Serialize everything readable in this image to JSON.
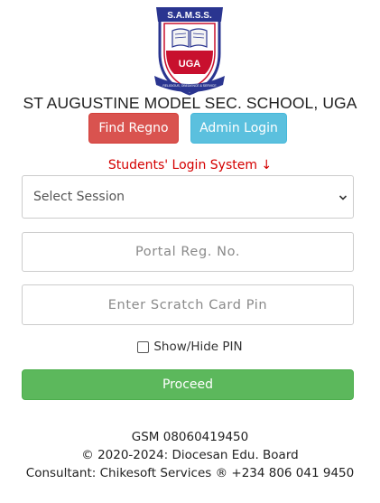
{
  "logo": {
    "banner_text": "S.A.M.S.S.",
    "shield_text": "UGA",
    "motto_text": "RELIGIOUS, OBEDIENCE & SERVICE"
  },
  "header": {
    "school_name": "ST AUGUSTINE MODEL SEC. SCHOOL, UGA"
  },
  "actions": {
    "find_regno": "Find Regno",
    "admin_login": "Admin Login"
  },
  "login": {
    "title": "Students' Login System ↓",
    "session_select_value": "Select Session",
    "reg_placeholder": "Portal Reg. No.",
    "pin_placeholder": "Enter Scratch Card Pin",
    "show_hide_label": "Show/Hide PIN",
    "proceed_label": "Proceed"
  },
  "footer": {
    "gsm": "GSM 08060419450",
    "copyright": "© 2020-2024: Diocesan Edu. Board",
    "consultant": "Consultant: Chikesoft Services ® +234 806 041 9450"
  },
  "colors": {
    "danger": "#d9534f",
    "info": "#5bc0de",
    "success": "#5cb85c",
    "title_red": "#d40000",
    "logo_navy": "#2a3590",
    "logo_red": "#c8102e"
  },
  "icons": {
    "select_chevron": "chevron-down-icon",
    "book": "open-book-icon"
  }
}
